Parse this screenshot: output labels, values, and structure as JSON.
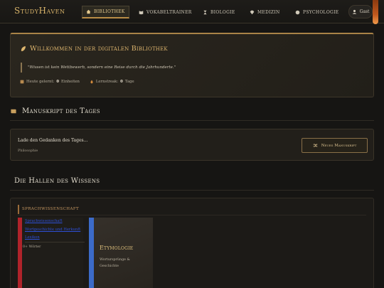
{
  "brand": "StudyHaven",
  "nav": [
    {
      "label": "Bibliothek",
      "icon": "home-icon",
      "active": true
    },
    {
      "label": "Vokabeltrainer",
      "icon": "book-icon",
      "active": false
    },
    {
      "label": "Biologie",
      "icon": "hourglass-icon",
      "active": false
    },
    {
      "label": "Medizin",
      "icon": "gem-icon",
      "active": false
    },
    {
      "label": "Psychologie",
      "icon": "brain-icon",
      "active": false
    }
  ],
  "user": {
    "label": "Gast",
    "icon": "user-icon"
  },
  "welcome": {
    "title": "Willkommen in der digitalen Bibliothek",
    "quote": "\"Wissen ist kein Wettbewerb, sondern eine Reise durch die Jahrhunderte.\"",
    "stats": [
      {
        "label": "Heute gelernt:",
        "value": "0",
        "unit": "Einheiten",
        "icon": "book-icon"
      },
      {
        "label": "Lernstreak:",
        "value": "0",
        "unit": "Tage",
        "icon": "flame-icon"
      }
    ]
  },
  "manuscript": {
    "heading": "Manuskript des Tages",
    "loading_text": "Lade den Gedanken des Tages...",
    "category": "Philosophie",
    "button_label": "Neues Manuskript"
  },
  "halls": {
    "heading": "Die Hallen des Wissens",
    "category": "Sprachwissenschaft",
    "card1": {
      "links": [
        "Sprachwissenschaft",
        "Wortgeschichte und Herkunft",
        "Lexikon"
      ],
      "words": "0+ Wörter"
    },
    "card2": {
      "title": "Etymologie",
      "subtitle": "Wortursprünge & Geschichte"
    }
  },
  "colors": {
    "accent": "#d9b46a",
    "background": "#161513",
    "card1_stripe": "#b0232a",
    "card2_stripe": "#3c6bc9"
  }
}
